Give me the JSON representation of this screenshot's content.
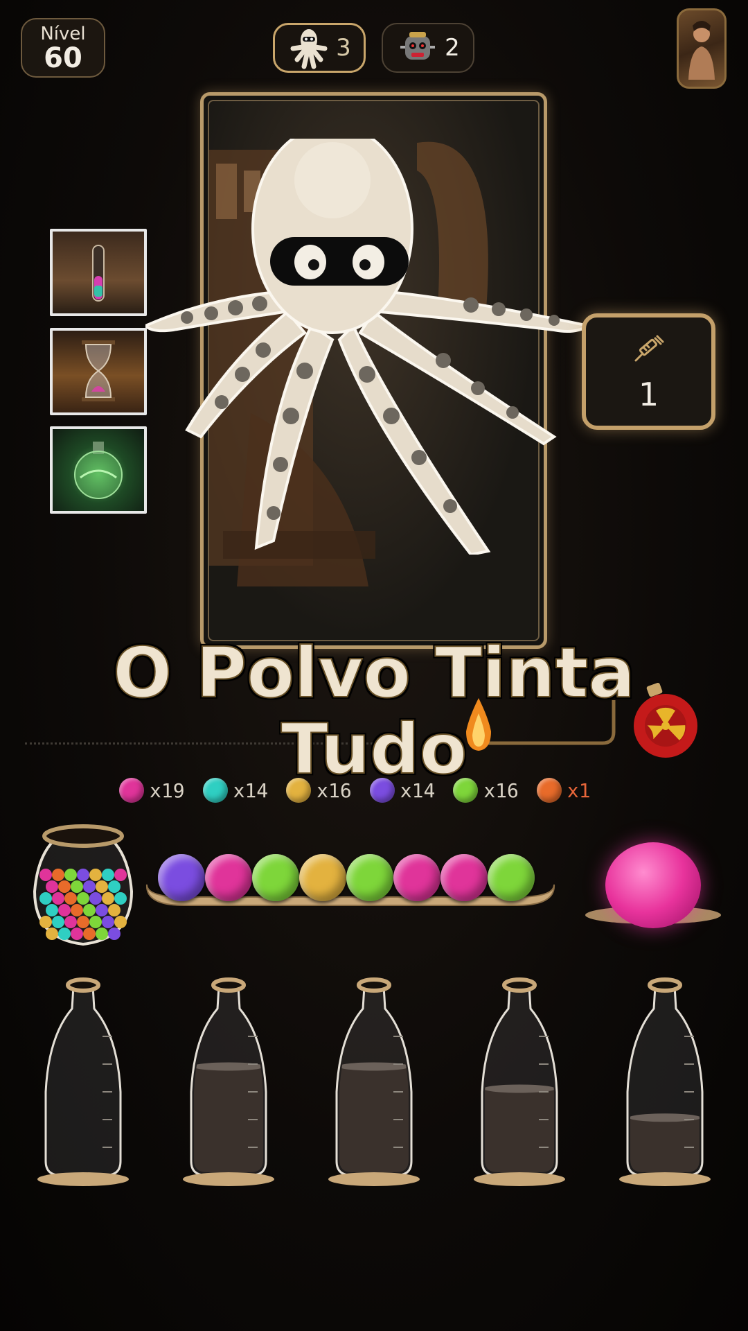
{
  "header": {
    "level_label": "Nível",
    "level_value": "60",
    "counters": [
      {
        "icon": "octopus-icon",
        "value": "3",
        "active": true
      },
      {
        "icon": "robot-icon",
        "value": "2",
        "active": false
      }
    ]
  },
  "card": {
    "character": "octopus",
    "title": "O Polvo Tinta Tudo"
  },
  "booster": {
    "icon": "syringe-icon",
    "count": "1"
  },
  "ball_counts": [
    {
      "color": "#e0349a",
      "label": "x19",
      "alert": false
    },
    {
      "color": "#2fcfc2",
      "label": "x14",
      "alert": false
    },
    {
      "color": "#e3b23f",
      "label": "x16",
      "alert": false
    },
    {
      "color": "#7b4de0",
      "label": "x14",
      "alert": false
    },
    {
      "color": "#7ed63a",
      "label": "x16",
      "alert": false
    },
    {
      "color": "#e86b2a",
      "label": "x1",
      "alert": true
    }
  ],
  "queue_colors": [
    "#7b4de0",
    "#e0349a",
    "#7ed63a",
    "#e3b23f",
    "#7ed63a",
    "#e0349a",
    "#e0349a",
    "#7ed63a"
  ],
  "next_ball_color": "#e8339c",
  "bottles": [
    {
      "fill": 0.0
    },
    {
      "fill": 0.62
    },
    {
      "fill": 0.62
    },
    {
      "fill": 0.49
    },
    {
      "fill": 0.32
    }
  ]
}
